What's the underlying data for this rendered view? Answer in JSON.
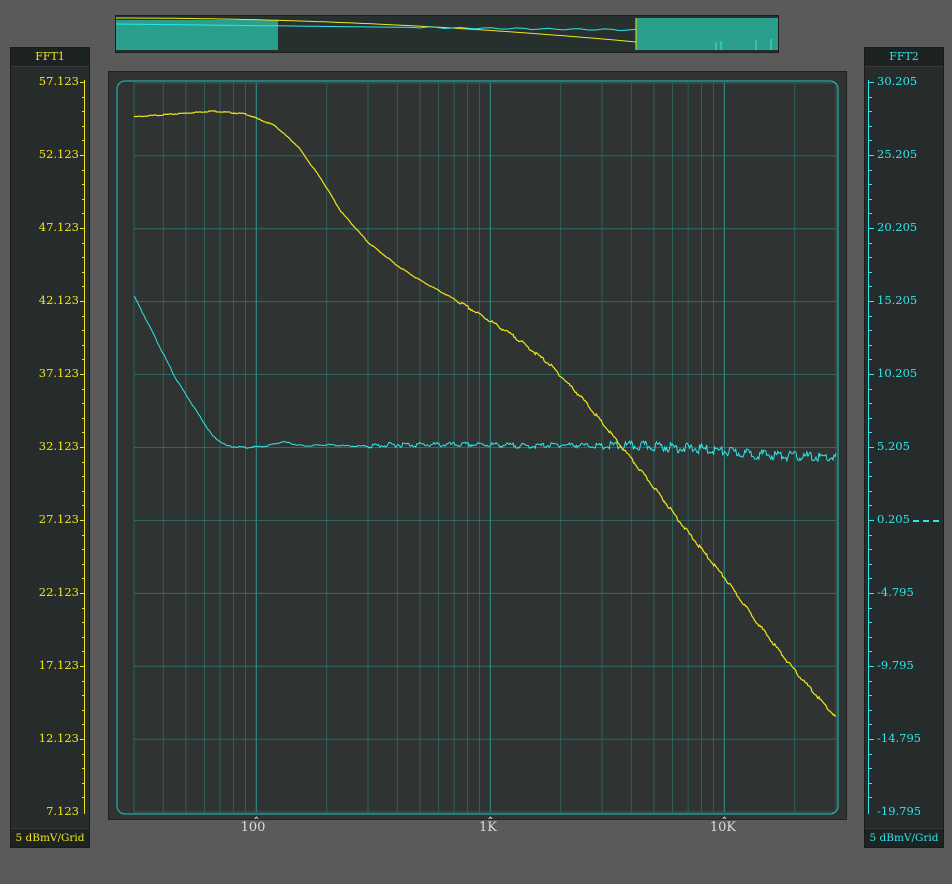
{
  "panels": {
    "left": {
      "title": "FFT1",
      "footer": "5 dBmV/Grid",
      "color": "#f0e61c",
      "ticks": [
        "57.123",
        "52.123",
        "47.123",
        "42.123",
        "37.123",
        "32.123",
        "27.123",
        "22.123",
        "17.123",
        "12.123",
        "7.123"
      ]
    },
    "right": {
      "title": "FFT2",
      "footer": "5 dBmV/Grid",
      "color": "#2fe6ea",
      "ticks": [
        "30.205",
        "25.205",
        "20.205",
        "15.205",
        "10.205",
        "5.205",
        "0.205",
        "-4.795",
        "-9.795",
        "-14.795",
        "-19.795"
      ]
    }
  },
  "xaxis": {
    "labels": [
      "100",
      "1K",
      "10K"
    ]
  },
  "colors": {
    "fft1": "#f0e61c",
    "fft2": "#2fe6ea",
    "grid": "#2c8a82",
    "background": "#2f3332",
    "overview_fill": "#2aa08c"
  },
  "chart_data": {
    "type": "line",
    "x_scale": "log",
    "xlim": [
      30,
      30000
    ],
    "series": [
      {
        "axis": "left",
        "ylim": [
          7.123,
          57.123
        ],
        "x": [
          30,
          45,
          65,
          90,
          120,
          150,
          190,
          230,
          300,
          400,
          500,
          700,
          1000,
          1300,
          1800,
          2500,
          3500,
          5000,
          7000,
          10000,
          14000,
          20000,
          30000
        ],
        "y": [
          54.8,
          55.0,
          55.2,
          55.0,
          54.2,
          52.8,
          50.5,
          48.3,
          46.2,
          44.6,
          43.6,
          42.3,
          40.8,
          39.6,
          37.8,
          35.4,
          32.5,
          29.4,
          26.3,
          23.2,
          20.0,
          16.8,
          13.6
        ]
      },
      {
        "axis": "right",
        "ylim": [
          -19.795,
          30.205
        ],
        "x": [
          30,
          35,
          45,
          55,
          65,
          75,
          90,
          110,
          130,
          160,
          200,
          250,
          300,
          400,
          600,
          1000,
          1500,
          2000,
          3000,
          5000,
          8000,
          12000,
          20000,
          30000
        ],
        "y": [
          15.6,
          13.5,
          10.0,
          7.8,
          6.0,
          5.3,
          5.2,
          5.3,
          5.6,
          5.3,
          5.4,
          5.3,
          5.3,
          5.4,
          5.4,
          5.4,
          5.3,
          5.4,
          5.3,
          5.3,
          5.1,
          4.8,
          4.6,
          4.5
        ]
      }
    ]
  }
}
